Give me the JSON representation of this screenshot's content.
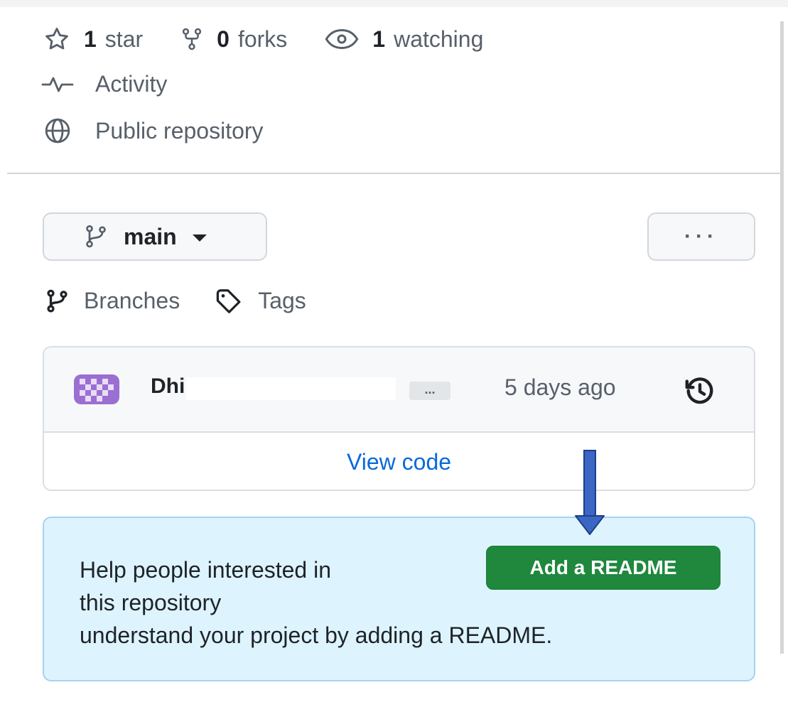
{
  "stats": {
    "stars_count": "1",
    "stars_label": "star",
    "forks_count": "0",
    "forks_label": "forks",
    "watching_count": "1",
    "watching_label": "watching"
  },
  "activity_label": "Activity",
  "visibility_label": "Public repository",
  "branch_selector": {
    "current": "main"
  },
  "more_button_label": "···",
  "nav": {
    "branches": "Branches",
    "tags": "Tags"
  },
  "latest_commit": {
    "author_visible_fragment": "Dhi",
    "message_ellipsis": "...",
    "time": "5 days ago",
    "view_code": "View code"
  },
  "readme_prompt": {
    "line1": "Help people interested in",
    "line2": "this repository",
    "line3": "understand your project by adding a README.",
    "button": "Add a README"
  },
  "colors": {
    "primary_button": "#1f883d",
    "link": "#0969da",
    "callout_bg": "#ddf4ff",
    "annotation_arrow": "#3b66c4"
  }
}
